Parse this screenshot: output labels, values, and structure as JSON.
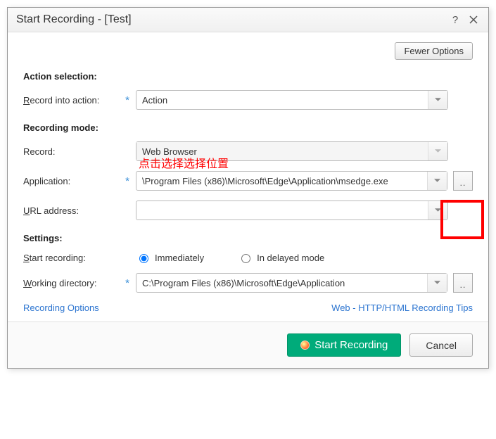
{
  "titlebar": {
    "title": "Start Recording - [Test]"
  },
  "topbar": {
    "fewer_options": "Fewer Options"
  },
  "sections": {
    "action_selection": "Action selection:",
    "recording_mode": "Recording mode:",
    "settings": "Settings:"
  },
  "labels": {
    "record_into_action": "Record into action:",
    "record": "Record:",
    "application": "Application:",
    "url_address": "URL address:",
    "start_recording": "Start recording:",
    "working_directory": "Working directory:"
  },
  "fields": {
    "record_into_action_value": "Action",
    "record_value": "Web Browser",
    "application_value": "\\Program Files (x86)\\Microsoft\\Edge\\Application\\msedge.exe",
    "url_address_value": "",
    "working_directory_value": "C:\\Program Files (x86)\\Microsoft\\Edge\\Application"
  },
  "radios": {
    "immediately": "Immediately",
    "delayed": "In delayed mode"
  },
  "links": {
    "recording_options": "Recording Options",
    "recording_tips": "Web - HTTP/HTML Recording Tips"
  },
  "footer": {
    "start_recording": "Start Recording",
    "cancel": "Cancel"
  },
  "annotation": {
    "text": "点击选择选择位置"
  }
}
